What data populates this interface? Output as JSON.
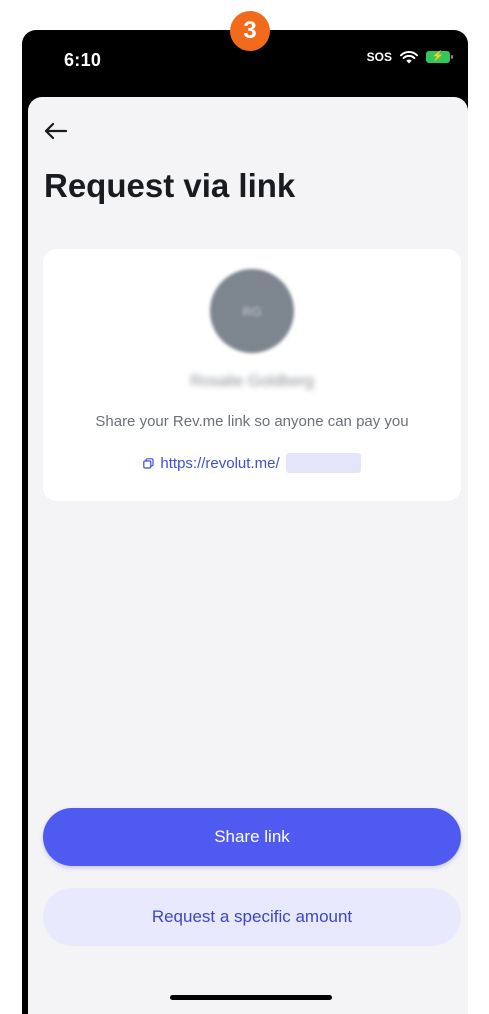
{
  "step_badge": "3",
  "status_bar": {
    "time": "6:10",
    "sos": "SOS"
  },
  "header": {
    "title": "Request via link"
  },
  "card": {
    "avatar_initials": "RG",
    "user_name": "Rosalie Goldberg",
    "share_text": "Share your Rev.me link so anyone can pay you",
    "link": "https://revolut.me/"
  },
  "actions": {
    "share_link": "Share link",
    "request_amount": "Request a specific amount"
  },
  "colors": {
    "primary": "#4f5bf0",
    "secondary_bg": "#e8e9fc",
    "badge": "#f26b1d",
    "link": "#3b50d6"
  },
  "icons": [
    "back-arrow-icon",
    "copy-icon",
    "wifi-icon",
    "battery-icon"
  ]
}
